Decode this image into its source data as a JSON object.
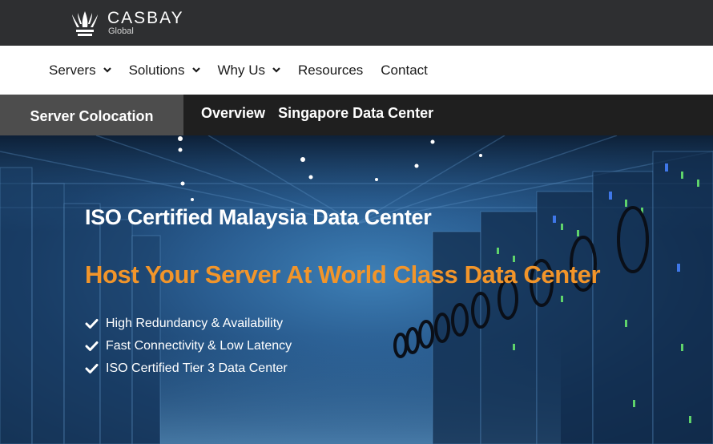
{
  "brand": {
    "name": "CASBAY",
    "sub": "Global"
  },
  "nav": {
    "items": [
      {
        "label": "Servers",
        "has_dropdown": true
      },
      {
        "label": "Solutions",
        "has_dropdown": true
      },
      {
        "label": "Why Us",
        "has_dropdown": true
      },
      {
        "label": "Resources",
        "has_dropdown": false
      },
      {
        "label": "Contact",
        "has_dropdown": false
      }
    ]
  },
  "subnav": {
    "active": "Server Colocation",
    "links": [
      "Overview",
      "Singapore Data Center"
    ]
  },
  "hero": {
    "heading": "ISO Certified Malaysia Data Center",
    "title": "Host Your Server At World Class Data Center",
    "features": [
      "High Redundancy & Availability",
      "Fast Connectivity & Low Latency",
      "ISO Certified Tier 3 Data Center"
    ]
  },
  "colors": {
    "brand_bar": "#2e2f31",
    "accent_orange": "#f2952a",
    "subnav_bg": "#1f1f1f",
    "subnav_active": "#4d4d4d"
  },
  "icons": [
    "crown-logo-icon",
    "chevron-down-icon",
    "check-icon"
  ]
}
